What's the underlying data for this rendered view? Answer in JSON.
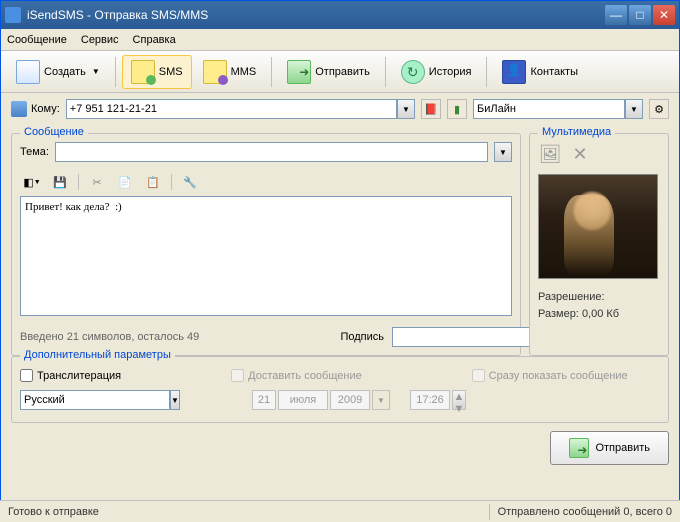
{
  "window": {
    "title": "iSendSMS - Отправка SMS/MMS"
  },
  "menu": {
    "message": "Сообщение",
    "service": "Сервис",
    "help": "Справка"
  },
  "toolbar": {
    "create": "Создать",
    "sms": "SMS",
    "mms": "MMS",
    "send": "Отправить",
    "history": "История",
    "contacts": "Контакты"
  },
  "to": {
    "label": "Кому:",
    "phone": "+7 951 121-21-21",
    "provider": "БиЛайн"
  },
  "message": {
    "legend": "Сообщение",
    "theme_label": "Тема:",
    "theme_value": "",
    "body": "Привет! как дела?  :)",
    "count": "Введено 21 символов, осталось 49",
    "signature_label": "Подпись",
    "signature_value": ""
  },
  "multimedia": {
    "legend": "Мультимедиа",
    "resolution_label": "Разрешение:",
    "resolution_value": "",
    "size_label": "Размер:",
    "size_value": "0,00 Кб"
  },
  "advanced": {
    "legend": "Дополнительный параметры",
    "translit": "Транслитерация",
    "language": "Русский",
    "deliver": "Доставить сообщение",
    "date_day": "21",
    "date_month": "июля",
    "date_year": "2009",
    "time": "17:26",
    "show_now": "Сразу показать сообщение"
  },
  "send_button": "Отправить",
  "status": {
    "ready": "Готово к отправке",
    "sent": "Отправлено сообщений 0, всего 0"
  }
}
